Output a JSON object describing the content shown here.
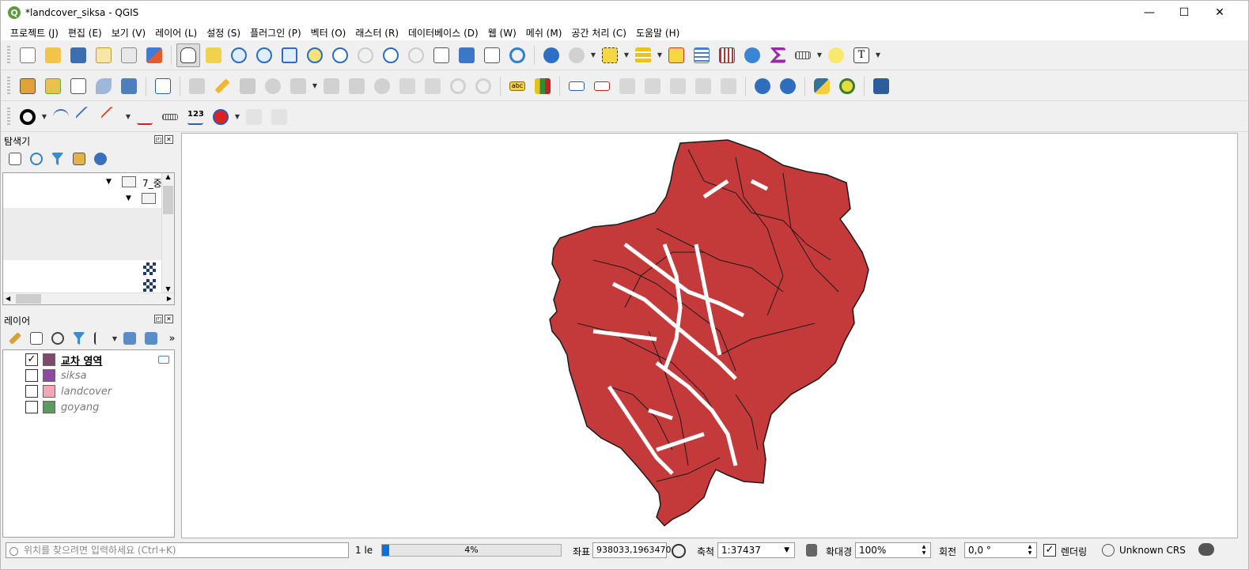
{
  "window": {
    "title": "*landcover_siksa - QGIS",
    "app_icon": "Q",
    "minimize": "—",
    "maximize": "☐",
    "close": "✕"
  },
  "menu": [
    "프로젝트 (J)",
    "편집 (E)",
    "보기 (V)",
    "레이어 (L)",
    "설정 (S)",
    "플러그인 (P)",
    "벡터 (O)",
    "래스터 (R)",
    "데이터베이스 (D)",
    "웹 (W)",
    "메쉬 (M)",
    "공간 처리 (C)",
    "도움말 (H)"
  ],
  "toolbar_labels": {
    "labeling_count": "123",
    "label_abc": "abc",
    "text_tool": "T"
  },
  "browser": {
    "title": "탐색기",
    "folder_label": "7_중"
  },
  "layers_panel": {
    "title": "레이어",
    "more": "»",
    "layers": [
      {
        "name": "교차 영역",
        "checked": true,
        "color": "#7d4a6b",
        "active": true
      },
      {
        "name": "siksa",
        "checked": false,
        "color": "#8e4aa0",
        "active": false
      },
      {
        "name": "landcover",
        "checked": false,
        "color": "#f2a7b6",
        "active": false
      },
      {
        "name": "goyang",
        "checked": false,
        "color": "#5d9a62",
        "active": false
      }
    ]
  },
  "map": {
    "fill_color": "#c43a3a",
    "stroke_color": "#1a1a1a",
    "background": "#ffffff"
  },
  "status": {
    "locator_placeholder": "위치를 찾으려면 입력하세요 (Ctrl+K)",
    "layer_count": "1 le",
    "progress_percent": 4,
    "progress_text": "4%",
    "coord_label": "좌표",
    "coord_value": "938033,1963470",
    "scale_label": "축척",
    "scale_value": "1:37437",
    "magnifier_label": "확대경",
    "magnifier_value": "100%",
    "rotation_label": "회전",
    "rotation_value": "0,0 °",
    "render_label": "렌더링",
    "render_checked": true,
    "crs": "Unknown CRS"
  }
}
